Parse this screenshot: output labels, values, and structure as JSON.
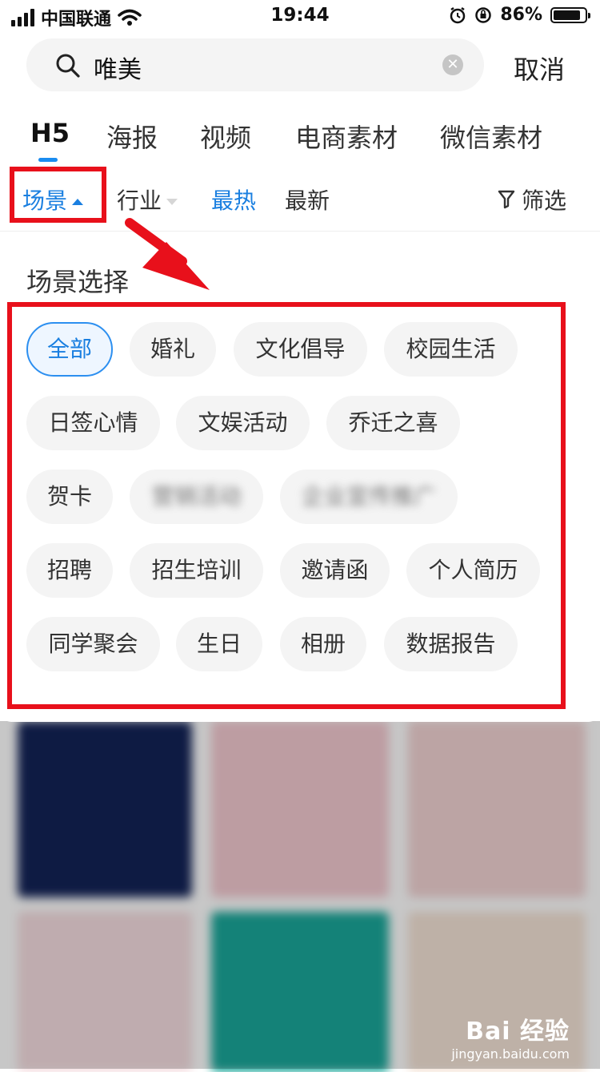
{
  "status_bar": {
    "carrier": "中国联通",
    "time": "19:44",
    "battery_percent": "86%",
    "battery_level": 0.86
  },
  "search": {
    "value": "唯美",
    "cancel_label": "取消"
  },
  "tabs": [
    {
      "label": "H5",
      "active": true
    },
    {
      "label": "海报",
      "active": false
    },
    {
      "label": "视频",
      "active": false
    },
    {
      "label": "电商素材",
      "active": false
    },
    {
      "label": "微信素材",
      "active": false
    }
  ],
  "filter_bar": {
    "scene_label": "场景",
    "industry_label": "行业",
    "hot_label": "最热",
    "new_label": "最新",
    "filter_label": "筛选"
  },
  "panel": {
    "title": "场景选择",
    "chips": [
      {
        "label": "全部",
        "selected": true
      },
      {
        "label": "婚礼"
      },
      {
        "label": "文化倡导"
      },
      {
        "label": "校园生活"
      },
      {
        "label": "日签心情"
      },
      {
        "label": "文娱活动"
      },
      {
        "label": "乔迁之喜"
      },
      {
        "label": "贺卡"
      },
      {
        "label": "营销活动",
        "blurred": true
      },
      {
        "label": "企业宣传推广",
        "blurred": true
      },
      {
        "label": "招聘"
      },
      {
        "label": "招生培训"
      },
      {
        "label": "邀请函"
      },
      {
        "label": "个人简历"
      },
      {
        "label": "同学聚会"
      },
      {
        "label": "生日"
      },
      {
        "label": "相册"
      },
      {
        "label": "数据报告"
      }
    ]
  },
  "colors": {
    "accent": "#1a7fe0",
    "highlight": "#e8101b",
    "chip_bg": "#f4f4f4"
  },
  "watermark": {
    "brand": "Bai 经验",
    "url": "jingyan.baidu.com"
  }
}
